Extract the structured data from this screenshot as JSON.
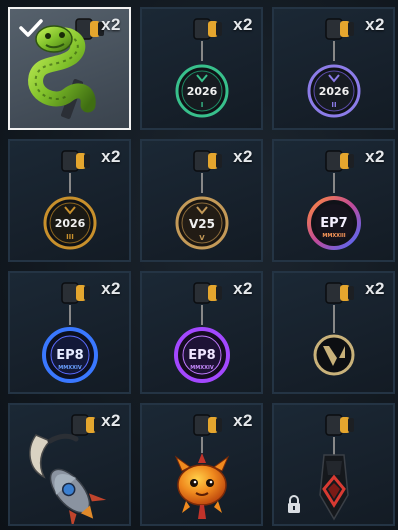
{
  "grid": {
    "items": [
      {
        "name": "green-serpent-charm",
        "count": "x2",
        "selected": true,
        "locked": false
      },
      {
        "name": "2026-i-medal-charm",
        "count": "x2",
        "selected": false,
        "locked": false,
        "label": "2026",
        "sub": "I",
        "ring": "#38c08c"
      },
      {
        "name": "2026-ii-medal-charm",
        "count": "x2",
        "selected": false,
        "locked": false,
        "label": "2026",
        "sub": "II",
        "ring": "#8c7ce8"
      },
      {
        "name": "2026-iii-medal-charm",
        "count": "x2",
        "selected": false,
        "locked": false,
        "label": "2026",
        "sub": "III",
        "ring": "#c8902c"
      },
      {
        "name": "v25-medal-charm",
        "count": "x2",
        "selected": false,
        "locked": false,
        "label": "V25",
        "sub": "V",
        "ring": "#c49a58"
      },
      {
        "name": "ep7-medal-charm",
        "count": "x2",
        "selected": false,
        "locked": false,
        "label": "EP7",
        "sub": "MMXXIII",
        "ring": "#e0703c"
      },
      {
        "name": "ep8-blue-medal-charm",
        "count": "x2",
        "selected": false,
        "locked": false,
        "label": "EP8",
        "sub": "MMXXIV",
        "ring": "#3a78ff"
      },
      {
        "name": "ep8-purple-medal-charm",
        "count": "x2",
        "selected": false,
        "locked": false,
        "label": "EP8",
        "sub": "MMXXIV",
        "ring": "#a348ff"
      },
      {
        "name": "valorant-logo-charm",
        "count": "x2",
        "selected": false,
        "locked": false,
        "ring": "#c9b27a"
      },
      {
        "name": "rocket-karambit-charm",
        "count": "x2",
        "selected": false,
        "locked": false
      },
      {
        "name": "orange-creature-charm",
        "count": "x2",
        "selected": false,
        "locked": false
      },
      {
        "name": "red-gem-pendant-charm",
        "count": "",
        "selected": false,
        "locked": true
      }
    ]
  },
  "colors": {
    "tile_border": "#243444",
    "selected_border": "#f2f2f2",
    "connector_gold": "#e5a62e",
    "count_text": "#e6e9ec"
  },
  "icons": {
    "check": "check-icon",
    "lock": "lock-icon",
    "clip": "charm-clip-icon"
  }
}
